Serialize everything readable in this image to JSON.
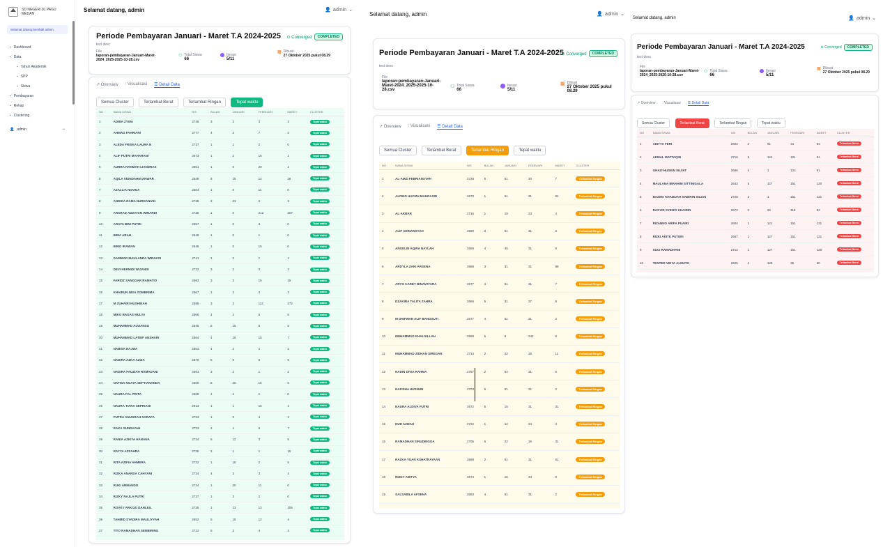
{
  "sidebar": {
    "brand": "SD NEGERI 01 PAGU MEDAN",
    "welcome": "Selamat datang kembali admin",
    "items": [
      {
        "label": "Dashboard",
        "icon": "dashboard-icon"
      },
      {
        "label": "Data",
        "icon": "chart-icon"
      },
      {
        "label": "Tahun Akademik",
        "icon": "calendar-icon",
        "sub": true
      },
      {
        "label": "SPP",
        "icon": "money-icon",
        "sub": true
      },
      {
        "label": "Siswa",
        "icon": "users-icon",
        "sub": true
      },
      {
        "label": "Pembayaran",
        "icon": "card-icon"
      },
      {
        "label": "Rekap",
        "icon": "file-icon"
      },
      {
        "label": "Clustering",
        "icon": "cluster-icon"
      }
    ],
    "user": "admin"
  },
  "topbars": [
    {
      "greet": "Selamat datang, admin",
      "admin": "admin"
    },
    {
      "greet": "Selamat datang, admin",
      "admin": "admin"
    },
    {
      "greet": "Selamat datang, admin",
      "admin": "admin"
    }
  ],
  "period": {
    "title": "Periode Pembayaran Januari - Maret T.A 2024-2025",
    "subtitle": "test desc",
    "converged": "Converged",
    "status": "COMPLETED",
    "file_label": "File",
    "file_value": "laporan-pembayaran-Januari-Maret-2024_2025-2025-10-28.csv",
    "total_label": "Total Siswa",
    "total_value": "66",
    "iter_label": "Iterasi",
    "iter_value": "5/11",
    "created_label": "Dibuat",
    "created_value": "27 Oktober 2025 pukul 08.29"
  },
  "tabs": {
    "overview": "Overview",
    "visual": "Visualisasi",
    "detail": "Detail Data"
  },
  "filters": {
    "all": "Semua Cluster",
    "heavy": "Terlambat Berat",
    "light": "Terlambat Ringan",
    "ontime": "Tepat waktu"
  },
  "headers": [
    "NO",
    "NAMA SISWA",
    "NIS",
    "BULAN",
    "JANUARI",
    "FEBRUARI",
    "MARET",
    "CLUSTER"
  ],
  "badge_ontime": "Tepat waktu",
  "badge_light": "Terlambat Ringan",
  "badge_heavy": "Terlambat Berat",
  "colors": {
    "ontime": "#10b981",
    "light": "#f59e0b",
    "heavy": "#ef4444",
    "accent": "#2563eb"
  },
  "rows_ontime": [
    [
      "1",
      "ADIBA ZYWA",
      "2745",
      "3",
      "3",
      "3",
      "3"
    ],
    [
      "2",
      "AHMAD FAHRIANI",
      "2777",
      "4",
      "2",
      "7",
      "2"
    ],
    [
      "3",
      "ALEDA FRISKA LAURA N",
      "2717",
      "1",
      "1",
      "2",
      "0"
    ],
    [
      "4",
      "ALIF PUTRI MAHARANI",
      "2673",
      "1",
      "2",
      "15",
      "1"
    ],
    [
      "5",
      "AURRA RAHMAH LIANDRAS",
      "2661",
      "1",
      "0",
      "20",
      "1"
    ],
    [
      "6",
      "AQILA ADINDAHNI ANWAR",
      "2649",
      "5",
      "15",
      "14",
      "26"
    ],
    [
      "7",
      "AZALLIA NOVIDA",
      "2664",
      "1",
      "0",
      "11",
      "0"
    ],
    [
      "8",
      "ANDIKA RAMA NURDANIAN",
      "2738",
      "2",
      "23",
      "2",
      "3"
    ],
    [
      "9",
      "ARSHAD ADZAYAN WINARDI",
      "2735",
      "1",
      "0",
      "212",
      "207"
    ],
    [
      "10",
      "ARAYA BINI PUTRI",
      "2657",
      "1",
      "0",
      "3",
      "0"
    ],
    [
      "11",
      "BIMA ARAH",
      "2649",
      "1",
      "0",
      "1",
      "0"
    ],
    [
      "12",
      "BIMO IRAWAN",
      "2645",
      "1",
      "0",
      "15",
      "0"
    ],
    [
      "13",
      "DAMMAR MAULANDA WIRAKSI",
      "2741",
      "1",
      "2",
      "1",
      "1"
    ],
    [
      "14",
      "DEVI HERMIDI WIJANDI",
      "2732",
      "3",
      "2",
      "3",
      "3"
    ],
    [
      "15",
      "FARIDZ SANGGAR RAMATIO",
      "2683",
      "3",
      "3",
      "15",
      "16"
    ],
    [
      "16",
      "KHAIRUN NISA SOMBRIMA",
      "2667",
      "1",
      "2",
      "3",
      "3"
    ],
    [
      "17",
      "M ZUHAIRI HUSHINAH",
      "2688",
      "3",
      "2",
      "112",
      "272"
    ],
    [
      "18",
      "MIKO BAGAS MULYA",
      "2666",
      "4",
      "4",
      "6",
      "6"
    ],
    [
      "19",
      "MUHAMMAD ALVIANSO",
      "2645",
      "5",
      "15",
      "5",
      "5"
    ],
    [
      "20",
      "MUHAMMAD LATIEF ANSHARI",
      "2664",
      "4",
      "18",
      "15",
      "7"
    ],
    [
      "21",
      "NABISA NAJWA",
      "2663",
      "4",
      "2",
      "2",
      "2"
    ],
    [
      "22",
      "NADIRA AZKA AZIZA",
      "2679",
      "5",
      "0",
      "5",
      "5"
    ],
    [
      "23",
      "NADIRA FAUZIAH RAMADANI",
      "2663",
      "3",
      "2",
      "1",
      "2"
    ],
    [
      "24",
      "NAFISA NGAYA SEPTIANANDA",
      "2666",
      "5",
      "20",
      "15",
      "5"
    ],
    [
      "25",
      "NAURA FAL PRITA",
      "2665",
      "4",
      "1",
      "1",
      "0"
    ],
    [
      "26",
      "NAURA TIARA SEPRIANI",
      "2613",
      "1",
      "1",
      "16",
      "4"
    ],
    [
      "27",
      "PUTRA ANUGRAH SARAFA",
      "2723",
      "1",
      "3",
      "4",
      "3"
    ],
    [
      "28",
      "RAKA SUNDAYAH",
      "2723",
      "2",
      "4",
      "9",
      "7"
    ],
    [
      "29",
      "RANIA AZKIYA HANANA",
      "2734",
      "5",
      "12",
      "3",
      "5"
    ],
    [
      "30",
      "RAYYA AZZAHRA",
      "2735",
      "2",
      "1",
      "1",
      "10"
    ],
    [
      "31",
      "RITA AZIFIA AHMERA",
      "2732",
      "1",
      "15",
      "2",
      "5"
    ],
    [
      "32",
      "RIZKA ANANDA CAHYANI",
      "2734",
      "4",
      "3",
      "3",
      "4"
    ],
    [
      "33",
      "RUKI ARMANDO",
      "2724",
      "1",
      "20",
      "11",
      "0"
    ],
    [
      "34",
      "RIZKY NAJLA PUTRI",
      "2727",
      "1",
      "3",
      "2",
      "0"
    ],
    [
      "35",
      "ROVKY ARKOZI DAHLEIL",
      "2735",
      "1",
      "13",
      "13",
      "105"
    ],
    [
      "36",
      "TAHMID SYADIRA MAULIYYAH",
      "2652",
      "5",
      "15",
      "12",
      "4"
    ],
    [
      "37",
      "TITO RAMADHAN SEMBIRING",
      "2712",
      "5",
      "3",
      "4",
      "3"
    ]
  ],
  "rows_light": [
    [
      "1",
      "AL-AMZI FEBRIANSYAH",
      "2728",
      "5",
      "61",
      "30",
      "7"
    ],
    [
      "2",
      "ALFINO HAFIZH MAHRASID",
      "2670",
      "1",
      "61",
      "31",
      "62"
    ],
    [
      "3",
      "AL-AKBAR",
      "2716",
      "1",
      "19",
      "23",
      "4"
    ],
    [
      "4",
      "ALIF ADRIANSYAH",
      "2680",
      "3",
      "61",
      "31",
      "2"
    ],
    [
      "5",
      "ANGELIN AQIRA NAYLAH",
      "2659",
      "4",
      "45",
      "31",
      "8"
    ],
    [
      "6",
      "ARDYLA ZAKI ARSENA",
      "2688",
      "3",
      "31",
      "31",
      "88"
    ],
    [
      "7",
      "ARYO CAREY BINAVATARA",
      "2677",
      "4",
      "61",
      "31",
      "7"
    ],
    [
      "8",
      "DZAKIRA TALITA ZAHRA",
      "2666",
      "5",
      "31",
      "27",
      "8"
    ],
    [
      "9",
      "M DHIFWAN ALIF BANGSUTI",
      "2677",
      "4",
      "61",
      "31",
      "2"
    ],
    [
      "10",
      "MUHAMMAD KHALIULLAH",
      "2668",
      "5",
      "8",
      "241",
      "8"
    ],
    [
      "11",
      "MUHAMMAD ZIDHAN SIREGAR",
      "2714",
      "2",
      "22",
      "28",
      "11"
    ],
    [
      "12",
      "NADIN DIVIA RAHMA",
      "2787",
      "2",
      "64",
      "31",
      "5"
    ],
    [
      "13",
      "NAFISHA HUSNUN",
      "2703",
      "5",
      "61",
      "31",
      "2"
    ],
    [
      "14",
      "NAURA ALDIVA PUTRI",
      "2672",
      "5",
      "15",
      "31",
      "31"
    ],
    [
      "15",
      "NUR AZIZAH",
      "2722",
      "1",
      "12",
      "24",
      "4"
    ],
    [
      "16",
      "RAMADHAN SINUDINGGA",
      "2705",
      "6",
      "22",
      "16",
      "31"
    ],
    [
      "17",
      "RAZKA YUAN KSHATRAYAAN",
      "2698",
      "2",
      "61",
      "31",
      "61"
    ],
    [
      "18",
      "RIZKY ADITYA",
      "2674",
      "1",
      "15",
      "24",
      "8"
    ],
    [
      "19",
      "SALSABILA AFSENA",
      "2683",
      "4",
      "61",
      "31",
      "2"
    ]
  ],
  "rows_heavy": [
    [
      "1",
      "ADITYA FERI",
      "2602",
      "2",
      "91",
      "31",
      "93"
    ],
    [
      "2",
      "AKMAL MATTAQIN",
      "2716",
      "5",
      "124",
      "101",
      "91"
    ],
    [
      "3",
      "GHAZI HUSEIN SILVAT",
      "2686",
      "4",
      "1",
      "124",
      "91"
    ],
    [
      "4",
      "MAULANA IBRAHIM SITTINIGALA",
      "2643",
      "5",
      "127",
      "151",
      "120"
    ],
    [
      "5",
      "NAZWA KHADIJAH SABIRIN SILDAI",
      "2728",
      "2",
      "1",
      "151",
      "121"
    ],
    [
      "6",
      "RASYID SYEHVI KHAIRIN",
      "2672",
      "2",
      "29",
      "118",
      "92"
    ],
    [
      "7",
      "RIZANNO ARIFA PUAIRI",
      "2604",
      "1",
      "121",
      "151",
      "121"
    ],
    [
      "8",
      "RIZKI ADITE PUTERI",
      "2667",
      "1",
      "127",
      "151",
      "121"
    ],
    [
      "9",
      "SUCI RAMADHANI",
      "2712",
      "1",
      "127",
      "151",
      "120"
    ],
    [
      "10",
      "TENTER VIDYA ALMATO",
      "2605",
      "4",
      "125",
      "95",
      "60"
    ]
  ]
}
